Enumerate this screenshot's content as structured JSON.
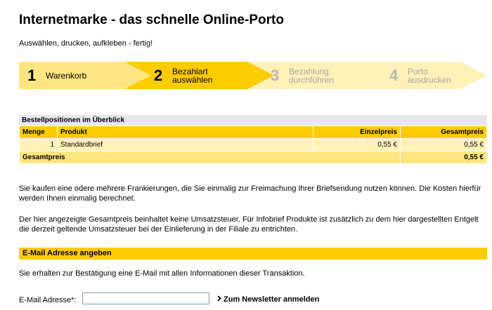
{
  "header": {
    "title": "Internetmarke - das schnelle Online-Porto",
    "subtitle": "Auswählen, drucken, aufkleben - fertig!"
  },
  "steps": [
    {
      "number": "1",
      "label_line1": "Warenkorb",
      "label_line2": "",
      "state": "done"
    },
    {
      "number": "2",
      "label_line1": "Bezahlart",
      "label_line2": "auswählen",
      "state": "active"
    },
    {
      "number": "3",
      "label_line1": "Bezahlung",
      "label_line2": "durchführen",
      "state": "pending"
    },
    {
      "number": "4",
      "label_line1": "Porto",
      "label_line2": "ausdrucken",
      "state": "pending"
    }
  ],
  "colors": {
    "step_done": "#ffe680",
    "step_active": "#ffcc00",
    "step_pending": "#fff1b8",
    "accent": "#ffcc00"
  },
  "order": {
    "heading": "Bestellpositionen im Überblick",
    "columns": [
      "Menge",
      "Produkt",
      "Einzelpreis",
      "Gesamtpreis"
    ],
    "rows": [
      {
        "menge": "1",
        "produkt": "Standardbrief",
        "einzelpreis": "0,55 €",
        "gesamtpreis": "0,55 €"
      }
    ],
    "total_label": "Gesamtpreis",
    "total_value": "0,55 €"
  },
  "info": {
    "p1": "Sie kaufen eine odere mehrere Frankierungen, die Sie einmalig zur Freimachung Ihrer Briefsendung nutzen können. Die Kosten hierfür werden Ihnen einmalig berechnet.",
    "p2": "Der hier angezeigte Gesamtpreis beinhaltet keine Umsatzsteuer. Für Infobrief Produkte ist zusätzlich zu dem hier dargestellten Entgelt die derzeit geltende Umsatzsteuer bei der Einlieferung in der Filiale zu entrichten."
  },
  "email": {
    "section_title": "E-Mail Adresse angeben",
    "description": "Sie erhalten zur Bestätigung eine E-Mail mit allen Informationen dieser Transaktion.",
    "label": "E-Mail Adresse*:",
    "value": "",
    "placeholder": "",
    "newsletter_link": "Zum Newsletter anmelden",
    "newsletter_icon": "chevron-right-icon"
  }
}
